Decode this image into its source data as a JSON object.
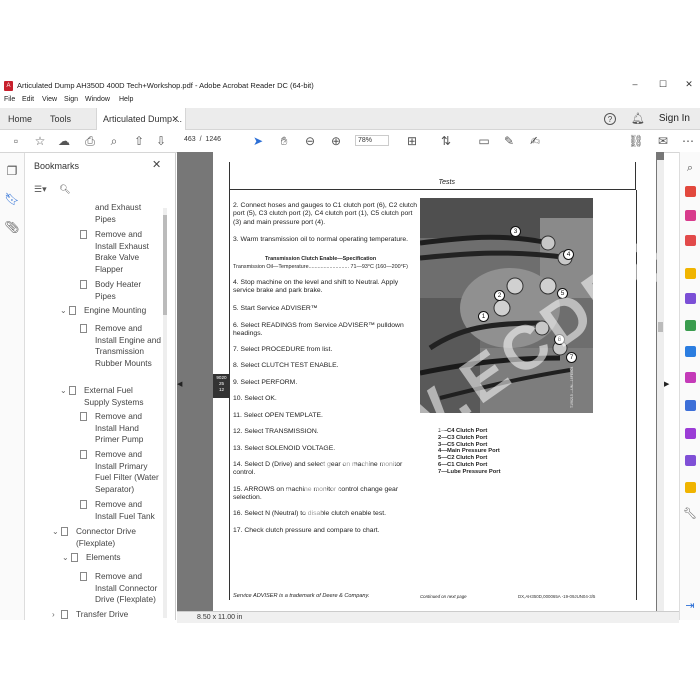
{
  "window": {
    "title": "Articulated Dump AH350D 400D Tech+Workshop.pdf - Adobe Acrobat Reader DC (64-bit)",
    "controls": [
      "–",
      "☐",
      "✕"
    ]
  },
  "menubar": [
    "File",
    "Edit",
    "View",
    "Sign",
    "Window",
    "Help"
  ],
  "tabs": {
    "home": "Home",
    "tools": "Tools",
    "document": "Articulated Dump ...",
    "sign_in": "Sign In"
  },
  "toolbar": {
    "current_page": "463",
    "page_separator": "/",
    "total_pages": "1246",
    "zoom": "78%"
  },
  "bookmarks": {
    "title": "Bookmarks",
    "items": [
      {
        "label": "and Exhaust Pipes",
        "level": 3,
        "chevron": false
      },
      {
        "label": "Remove and Install Exhaust Brake Valve Flapper",
        "level": 3,
        "chevron": false
      },
      {
        "label": "Body Heater Pipes",
        "level": 3,
        "chevron": false
      },
      {
        "label": "Engine Mounting",
        "level": 2,
        "chevron": true
      },
      {
        "label": "Remove and Install Engine and Transmission Rubber Mounts",
        "level": 3,
        "chevron": false
      },
      {
        "label": "External Fuel Supply Systems",
        "level": 2,
        "chevron": true
      },
      {
        "label": "Remove and Install Hand Primer Pump",
        "level": 3,
        "chevron": false
      },
      {
        "label": "Remove and Install Primary Fuel Filter (Water Separator)",
        "level": 3,
        "chevron": false
      },
      {
        "label": "Remove and Install Fuel Tank",
        "level": 3,
        "chevron": false
      },
      {
        "label": "Connector Drive (Flexplate)",
        "level": 1,
        "chevron": true
      },
      {
        "label": "Elements",
        "level": 2,
        "chevron": true
      },
      {
        "label": "Remove and Install Connector Drive (Flexplate)",
        "level": 3,
        "chevron": false
      },
      {
        "label": "Transfer Drive",
        "level": 1,
        "chevron": true
      }
    ]
  },
  "document": {
    "header": "Tests",
    "side_tab": [
      "9020",
      "25",
      "12"
    ],
    "steps": [
      "2.  Connect hoses and gauges to C1 clutch port (6), C2 clutch port (5), C3 clutch port (2), C4 clutch port (1), C5 clutch port (3) and main pressure port (4).",
      "3.  Warm transmission oil to normal operating temperature.",
      "4.  Stop machine on the level and shift to Neutral. Apply service brake and park brake.",
      "5.  Start Service ADVISER™",
      "6.  Select READINGS from Service ADVISER™ pulldown headings.",
      "7.  Select PROCEDURE from list.",
      "8.  Select CLUTCH TEST ENABLE.",
      "9.  Select PERFORM.",
      "10.  Select OK.",
      "11.  Select OPEN TEMPLATE.",
      "12.  Select TRANSMISSION.",
      "13.  Select SOLENOID VOLTAGE.",
      "14.  Select D (Drive) and select gear on machine monitor control.",
      "15.  ARROWS on machine monitor control change gear selection.",
      "16.  Select N (Neutral) to disable clutch enable test.",
      "17.  Check clutch pressure and compare to chart."
    ],
    "spec_title": "Transmission Clutch Enable—Specification",
    "spec_line": "Transmission Oil—Temperature...........................  71—93°C (160—200°F)",
    "legend": [
      "1—C4 Clutch Port",
      "2—C3 Clutch Port",
      "3—C5 Clutch Port",
      "4—Main Pressure Port",
      "5—C2 Clutch Port",
      "6—C1 Clutch Port",
      "7—Lube Pressure Port"
    ],
    "photo_callouts": [
      "1",
      "2",
      "3",
      "4",
      "5",
      "6",
      "7"
    ],
    "photo_side_code": "T196215 —UN—16FEB04",
    "footer_note": "Service ADVISER is a trademark of Deere & Company.",
    "footer_continued": "Continued on next page",
    "footer_code": "DX,AH350D,000065A  -19-09JUN04-3/5"
  },
  "watermark": "WWW.ECDEE.COM",
  "status": {
    "page_size": "8.50 x 11.00 in"
  },
  "colors": {
    "acrobat_red": "#c8202d",
    "viewer_bg": "#777777"
  }
}
